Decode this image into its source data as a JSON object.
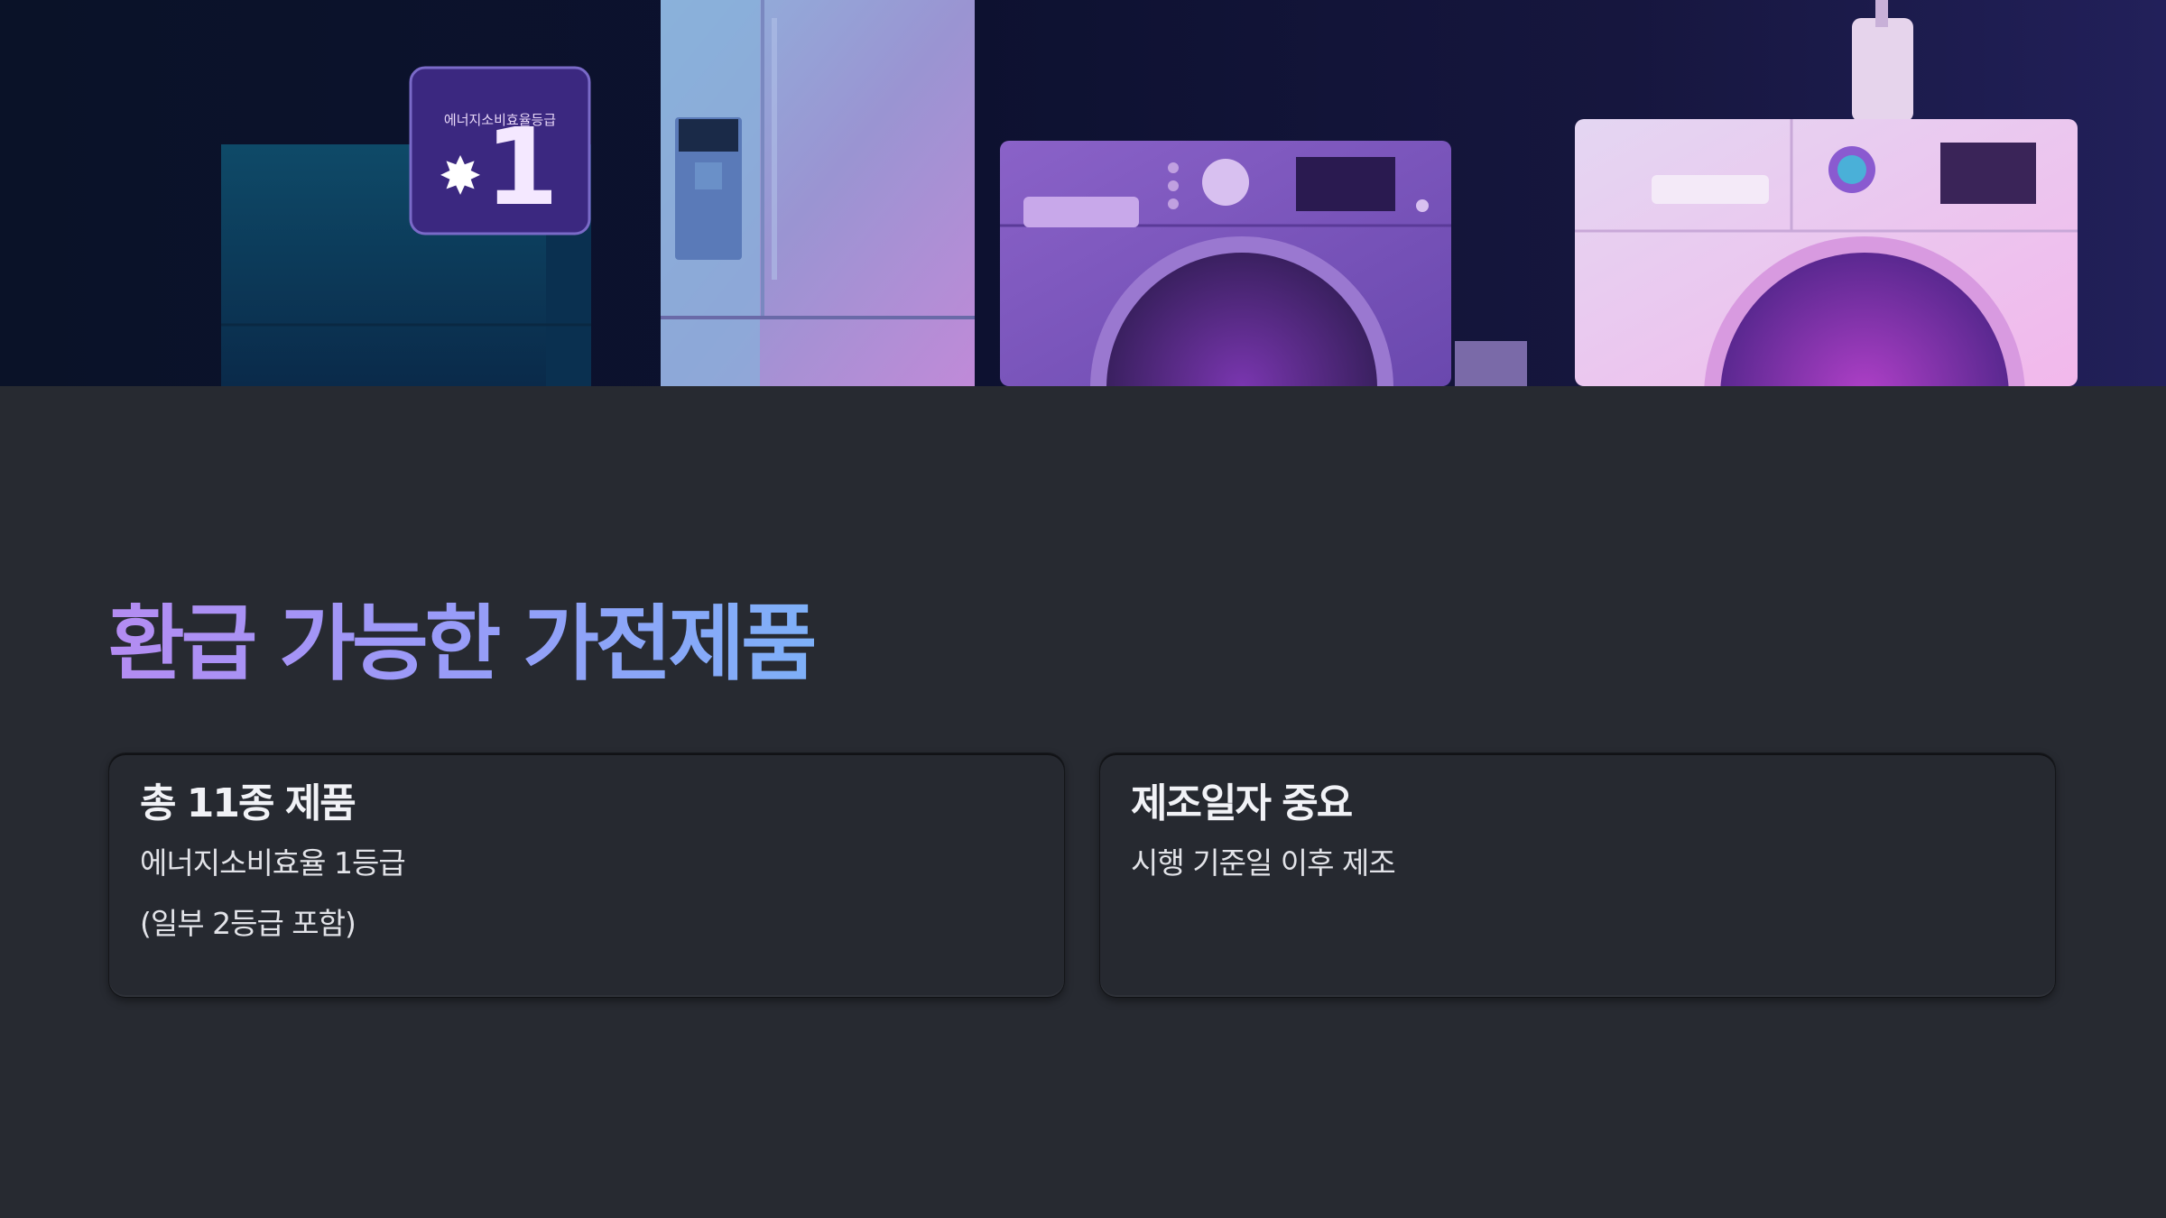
{
  "hero": {
    "badge_number": "1",
    "badge_caption": "에너지소비효율등급"
  },
  "section_title": "환급 가능한 가전제품",
  "cards": [
    {
      "title": "총 11종 제품",
      "lines": [
        "에너지소비효율 1등급",
        "(일부 2등급 포함)"
      ]
    },
    {
      "title": "제조일자 중요",
      "lines": [
        "시행 기준일 이후 제조"
      ]
    }
  ],
  "colors": {
    "background": "#272a31",
    "title_gradient_start": "#b48cf2",
    "title_gradient_end": "#7eb0f8",
    "card_bg": "#262930"
  }
}
